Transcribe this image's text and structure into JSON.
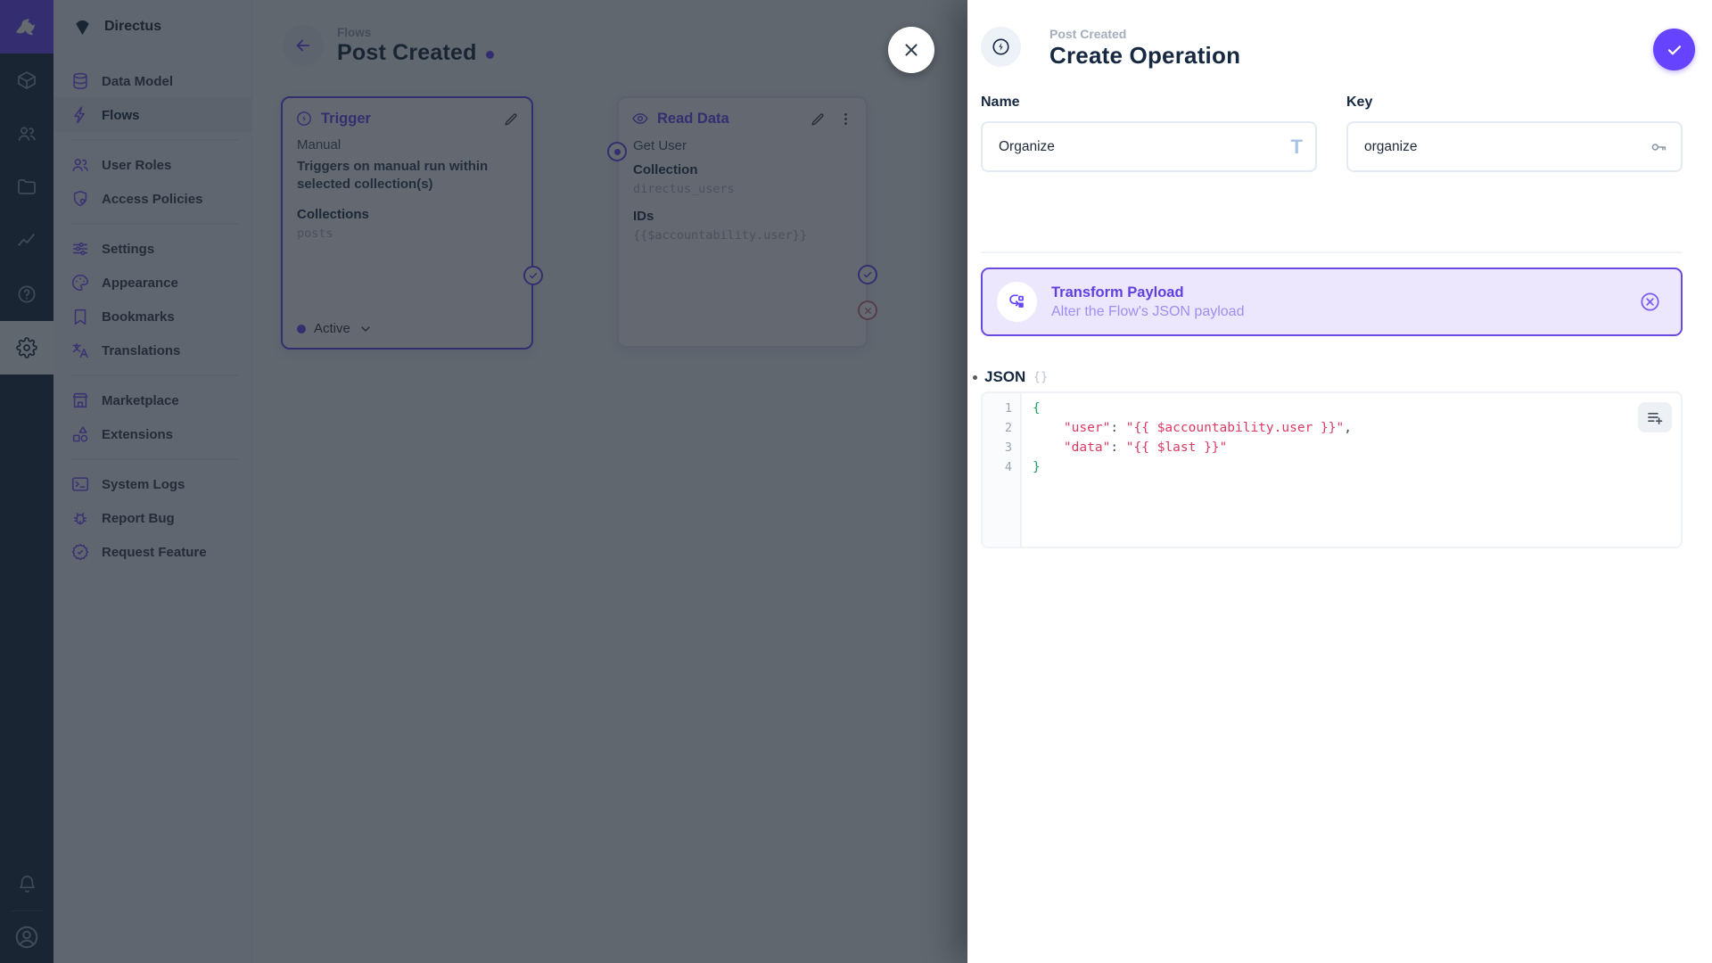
{
  "app": {
    "accent_color": "#6644ff",
    "dark_color": "#172940"
  },
  "module_bar": {
    "modules": [
      "content",
      "user-directory",
      "file-library",
      "insights",
      "documentation",
      "settings"
    ],
    "active_module": "settings",
    "bottom": [
      "notifications",
      "profile"
    ]
  },
  "sidebar": {
    "header": "Directus",
    "sections": [
      {
        "items": [
          {
            "icon": "database-icon",
            "label": "Data Model"
          },
          {
            "icon": "bolt-icon",
            "label": "Flows",
            "active": true
          }
        ]
      },
      {
        "items": [
          {
            "icon": "people-icon",
            "label": "User Roles"
          },
          {
            "icon": "shield-icon",
            "label": "Access Policies"
          }
        ]
      },
      {
        "items": [
          {
            "icon": "tune-icon",
            "label": "Settings"
          },
          {
            "icon": "palette-icon",
            "label": "Appearance"
          },
          {
            "icon": "bookmark-icon",
            "label": "Bookmarks"
          },
          {
            "icon": "translate-icon",
            "label": "Translations"
          }
        ]
      },
      {
        "items": [
          {
            "icon": "storefront-icon",
            "label": "Marketplace"
          },
          {
            "icon": "category-icon",
            "label": "Extensions"
          }
        ]
      },
      {
        "items": [
          {
            "icon": "terminal-icon",
            "label": "System Logs"
          },
          {
            "icon": "bug-icon",
            "label": "Report Bug"
          },
          {
            "icon": "verified-icon",
            "label": "Request Feature"
          }
        ]
      }
    ]
  },
  "canvas": {
    "breadcrumb": "Flows",
    "title": "Post Created",
    "trigger": {
      "title": "Trigger",
      "type": "Manual",
      "description": "Triggers on manual run within selected collection(s)",
      "collections_label": "Collections",
      "collections_value": "posts",
      "status": "Active"
    },
    "operation": {
      "title": "Read Data",
      "name": "Get User",
      "collection_label": "Collection",
      "collection_value": "directus_users",
      "ids_label": "IDs",
      "ids_value": "{{$accountability.user}}"
    }
  },
  "drawer": {
    "breadcrumb": "Post Created",
    "title": "Create Operation",
    "name_field": {
      "label": "Name",
      "value": "Organize"
    },
    "key_field": {
      "label": "Key",
      "value": "organize"
    },
    "transform_card": {
      "title": "Transform Payload",
      "subtitle": "Alter the Flow's JSON payload"
    },
    "json_editor": {
      "label": "JSON",
      "lines": [
        [
          [
            "brace",
            "{"
          ]
        ],
        [
          [
            "plain",
            "    "
          ],
          [
            "string",
            "\"user\""
          ],
          [
            "punct",
            ": "
          ],
          [
            "string",
            "\"{{ $accountability.user }}\""
          ],
          [
            "punct",
            ","
          ]
        ],
        [
          [
            "plain",
            "    "
          ],
          [
            "string",
            "\"data\""
          ],
          [
            "punct",
            ": "
          ],
          [
            "string",
            "\"{{ $last }}\""
          ]
        ],
        [
          [
            "brace",
            "}"
          ]
        ]
      ]
    }
  },
  "colors": {
    "code_string": "#dc3a63",
    "code_brace": "#1ea263",
    "reject": "#d77186"
  }
}
